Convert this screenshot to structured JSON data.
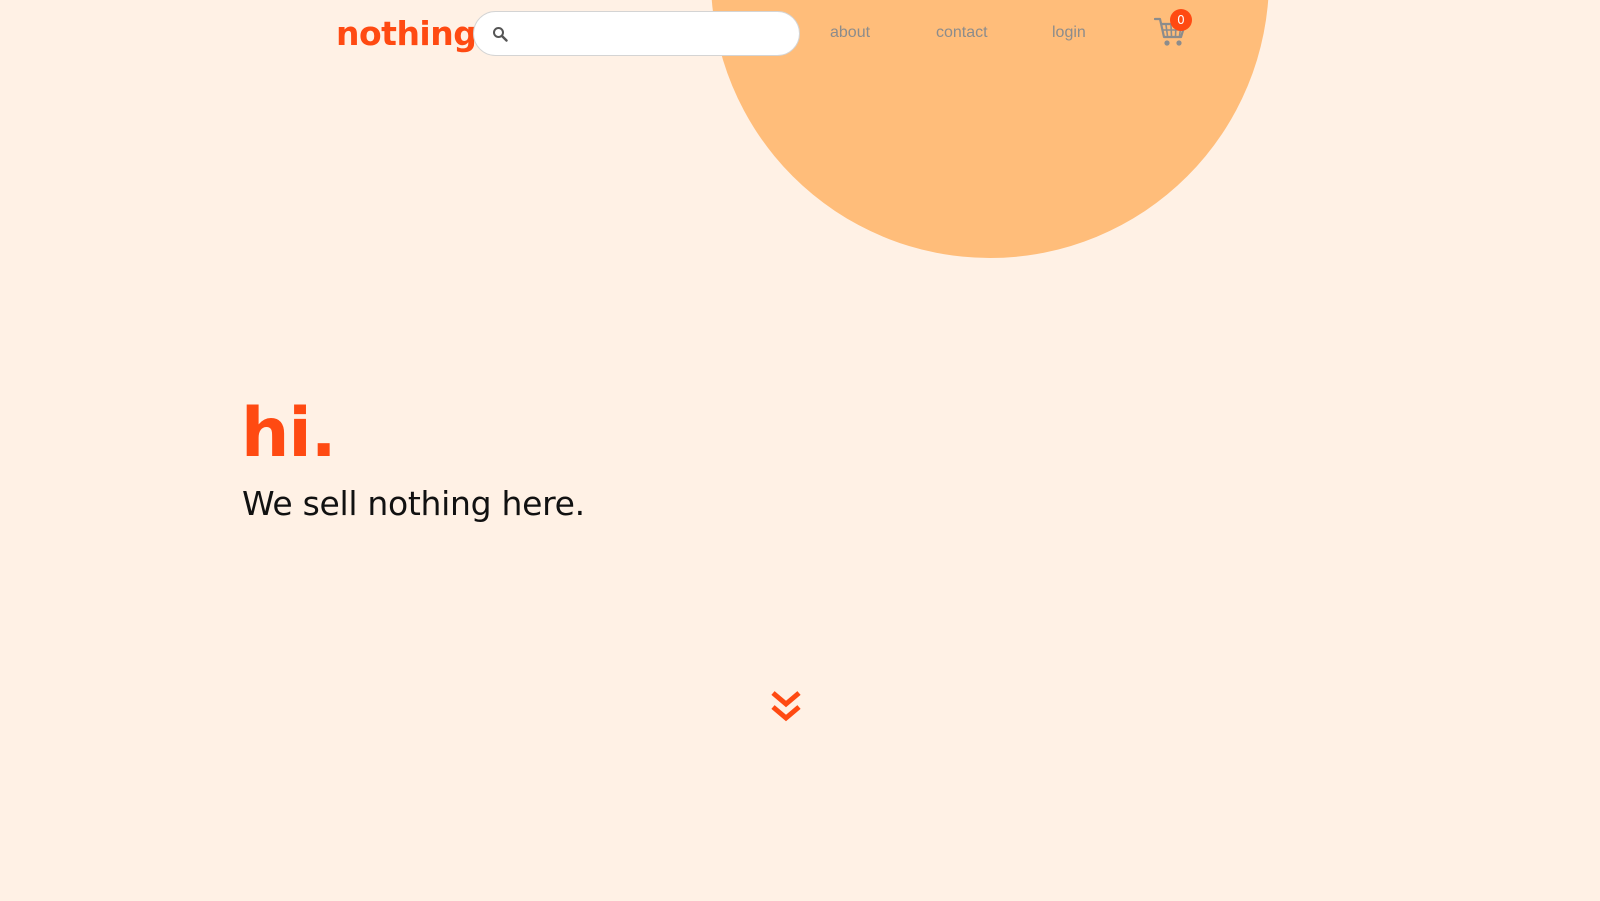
{
  "header": {
    "logo": "nothing",
    "search": {
      "placeholder": "",
      "value": ""
    },
    "nav": {
      "about": "about",
      "contact": "contact",
      "login": "login"
    },
    "cart": {
      "count": "0"
    }
  },
  "hero": {
    "title": "hi.",
    "subtitle": "We sell nothing here."
  },
  "icons": {
    "search": "search-icon",
    "cart": "cart-icon",
    "scroll": "double-chevron-down-icon"
  },
  "colors": {
    "background": "#fff1e5",
    "accent": "#ff4a12",
    "circle": "#ffbd7a",
    "nav_text": "#8c8c8c",
    "body_text": "#111111"
  }
}
